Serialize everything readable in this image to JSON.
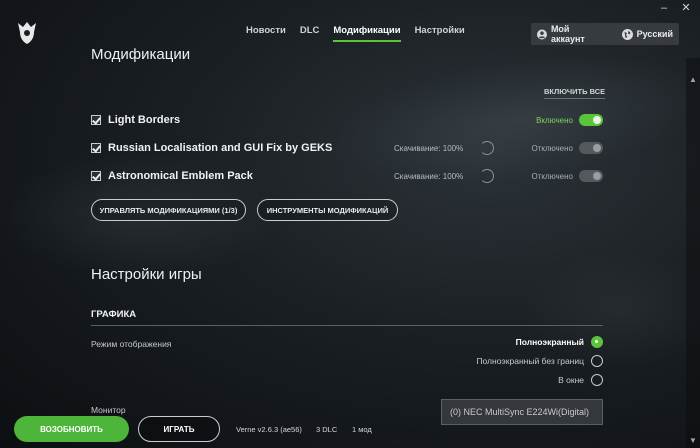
{
  "window": {
    "minimize_glyph": "–",
    "close_glyph": "✕"
  },
  "topnav": {
    "tabs": [
      {
        "label": "Новости"
      },
      {
        "label": "DLC"
      },
      {
        "label": "Модификации"
      },
      {
        "label": "Настройки"
      }
    ],
    "active_index": 2
  },
  "account": {
    "my_account": "Мой аккаунт",
    "language": "Русский"
  },
  "mods": {
    "title": "Модификации",
    "enable_all": "ВКЛЮЧИТЬ ВСЕ",
    "items": [
      {
        "name": "Light Borders",
        "download": "",
        "state": "Включено",
        "enabled": true
      },
      {
        "name": "Russian Localisation and GUI Fix by GEKS",
        "download": "Скачивание: 100%",
        "state": "Отключено",
        "enabled": false
      },
      {
        "name": "Astronomical Emblem Pack",
        "download": "Скачивание: 100%",
        "state": "Отключено",
        "enabled": false
      }
    ],
    "manage_button": "УПРАВЛЯТЬ МОДИФИКАЦИЯМИ (1/3)",
    "tools_button": "ИНСТРУМЕНТЫ МОДИФИКАЦИЙ"
  },
  "settings": {
    "title": "Настройки игры",
    "graphics": {
      "section_title": "ГРАФИКА",
      "display_mode_label": "Режим отображения",
      "display_modes": [
        {
          "label": "Полноэкранный",
          "selected": true
        },
        {
          "label": "Полноэкранный без границ",
          "selected": false
        },
        {
          "label": "В окне",
          "selected": false
        }
      ],
      "monitor_label": "Монитор",
      "monitor_value": "(0) NEC MultiSync E224Wi(Digital)"
    }
  },
  "bottom": {
    "resume_button": "ВОЗОБНОВИТЬ",
    "play_button": "ИГРАТЬ",
    "version": "Verne v2.6.3 (ae56)",
    "dlc_count": "3 DLC",
    "mod_count": "1 мод"
  },
  "colors": {
    "accent": "#5bc43b",
    "background": "#1a1f23"
  }
}
